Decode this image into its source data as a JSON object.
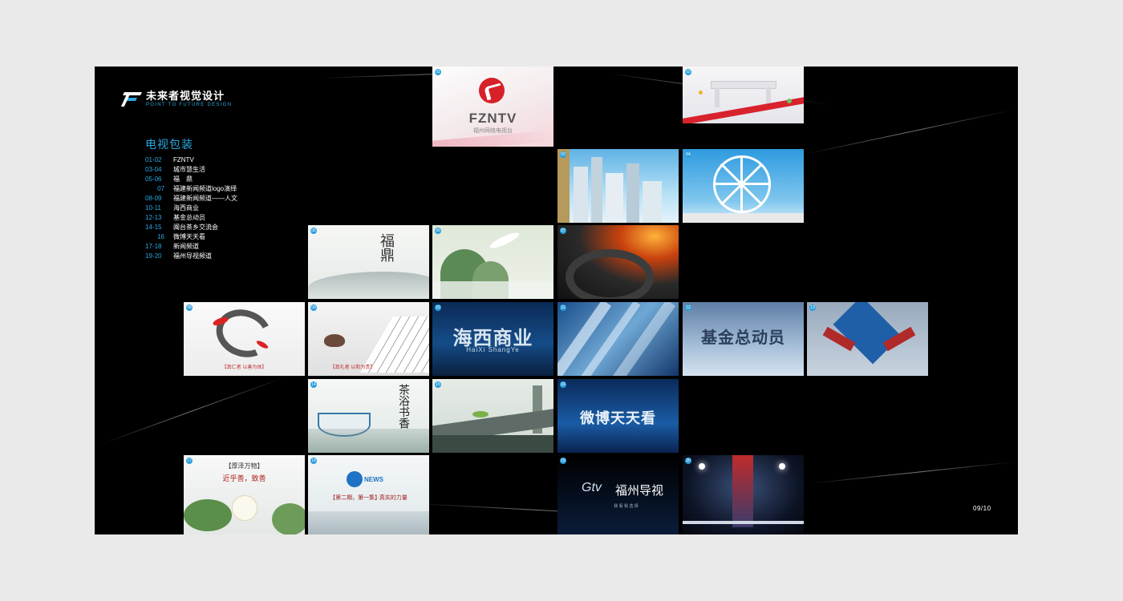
{
  "brand": {
    "name_cn": "未来者视觉设计",
    "name_en": "POINT TO FUTURE DESIGN"
  },
  "section_title": "电视包装",
  "toc": [
    {
      "num": "01-02",
      "label": "FZNTV"
    },
    {
      "num": "03-04",
      "label": "城市慧生活"
    },
    {
      "num": "05-06",
      "label": "福　鼎"
    },
    {
      "num": "07",
      "label": "福建新闻频道logo演绎"
    },
    {
      "num": "08-09",
      "label": "福建新闻频道——人文"
    },
    {
      "num": "10-11",
      "label": "海西商业"
    },
    {
      "num": "12-13",
      "label": "基金总动员"
    },
    {
      "num": "14-15",
      "label": "闽台茶乡交流会"
    },
    {
      "num": "16",
      "label": "微博天天看"
    },
    {
      "num": "17-18",
      "label": "新闻频道"
    },
    {
      "num": "19-20",
      "label": "福州导视频道"
    }
  ],
  "page_number": "09/10",
  "tiles": {
    "t01": {
      "badge": "01",
      "title": "FZNTV",
      "subtitle": "福州网络电视台"
    },
    "t02": {
      "badge": "02"
    },
    "t03": {
      "badge": "03"
    },
    "t04": {
      "badge": "04"
    },
    "t05": {
      "badge": "05",
      "calligraphy": "福鼎"
    },
    "t06": {
      "badge": "06"
    },
    "t07": {
      "badge": "07"
    },
    "t08": {
      "badge": "08",
      "caption": "【真仁者 以善为体】"
    },
    "t09": {
      "badge": "09",
      "caption": "【真礼者 以和为贵】"
    },
    "t10": {
      "badge": "10",
      "title": "海西商业",
      "subtitle": "HaiXi ShangYe"
    },
    "t11": {
      "badge": "11"
    },
    "t12": {
      "badge": "12",
      "title": "基金总动员"
    },
    "t13": {
      "badge": "13"
    },
    "t14": {
      "badge": "14",
      "calligraphy": "茶浴书香"
    },
    "t15": {
      "badge": "15"
    },
    "t16": {
      "badge": "16",
      "title": "微博天天看"
    },
    "t17": {
      "badge": "17",
      "caption": "【厚泽万物】",
      "caption2": "近乎善，致善"
    },
    "t18": {
      "badge": "18",
      "logo": "NEWS",
      "caption": "【第二期，第一集】·真实的力量"
    },
    "t19": {
      "badge": "19",
      "logo": "Gtv",
      "title": "福州导视",
      "subtitle": "我 看 我 选 择"
    },
    "t20": {
      "badge": "20"
    }
  },
  "colors": {
    "accent": "#29a8e0",
    "page_bg": "#000000",
    "outer_bg": "#eaeaea"
  }
}
